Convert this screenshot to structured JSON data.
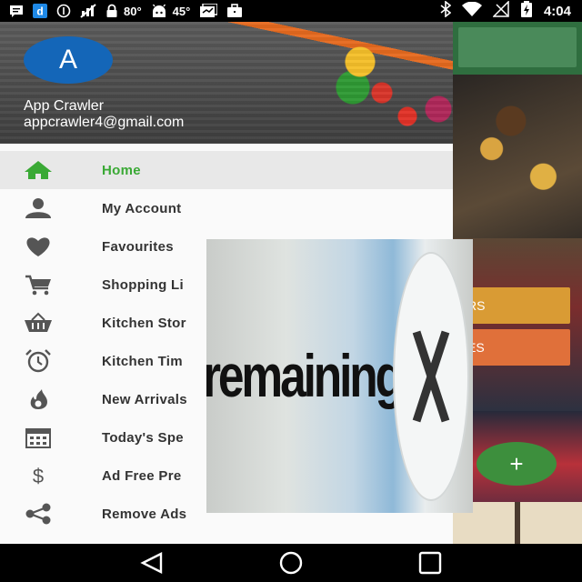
{
  "status_bar": {
    "temp_1": "80°",
    "temp_2": "45°",
    "time": "4:04"
  },
  "drawer": {
    "avatar_letter": "A",
    "user_name": "App Crawler",
    "user_email": "appcrawler4@gmail.com",
    "items": [
      {
        "label": "Home",
        "icon": "home-icon",
        "active": true
      },
      {
        "label": "My Account",
        "icon": "person-icon"
      },
      {
        "label": "Favourites",
        "icon": "heart-icon"
      },
      {
        "label": "Shopping Li",
        "icon": "cart-icon"
      },
      {
        "label": "Kitchen Stor",
        "icon": "basket-icon"
      },
      {
        "label": "Kitchen Tim",
        "icon": "alarm-clock-icon"
      },
      {
        "label": "New Arrivals",
        "icon": "flame-icon"
      },
      {
        "label": "Today's Spe",
        "icon": "calendar-icon"
      },
      {
        "label": "Ad Free Pre",
        "icon": "dollar-icon"
      },
      {
        "label": "Remove Ads",
        "icon": "share-icon"
      }
    ]
  },
  "background_app": {
    "button_1": "RS",
    "button_2": "ES",
    "fab_label": "+"
  },
  "ad": {
    "text": "remaining",
    "close_label": "X"
  },
  "colors": {
    "accent_green": "#3aa935",
    "avatar_blue": "#1466b8",
    "icon_gray": "#555555"
  }
}
